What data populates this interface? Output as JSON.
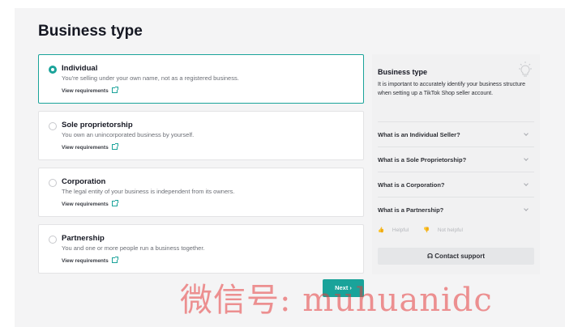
{
  "page": {
    "title": "Business type"
  },
  "options": [
    {
      "label": "Individual",
      "desc": "You're selling under your own name, not as a registered business.",
      "link": "View requirements",
      "selected": true
    },
    {
      "label": "Sole proprietorship",
      "desc": "You own an unincorporated business by yourself.",
      "link": "View requirements",
      "selected": false
    },
    {
      "label": "Corporation",
      "desc": "The legal entity of your business is independent from its owners.",
      "link": "View requirements",
      "selected": false
    },
    {
      "label": "Partnership",
      "desc": "You and one or more people run a business together.",
      "link": "View requirements",
      "selected": false
    }
  ],
  "side": {
    "title": "Business type",
    "text": "It is important to accurately identify your business structure when setting up a TikTok Shop seller account.",
    "faqs": [
      "What is an Individual Seller?",
      "What is a Sole Proprietorship?",
      "What is a Corporation?",
      "What is a Partnership?"
    ],
    "helpful": "Helpful",
    "not_helpful": "Not helpful",
    "support": "Contact support"
  },
  "footer": {
    "next": "Next"
  },
  "watermark": "微信号: muhuanidc",
  "colors": {
    "accent": "#1aa39a",
    "watermark": "#e63c3c"
  },
  "icons": [
    "lightbulb-icon",
    "external-link-icon",
    "chevron-down-icon",
    "thumbs-up-icon",
    "thumbs-down-icon",
    "headset-icon",
    "chevron-right-icon"
  ]
}
